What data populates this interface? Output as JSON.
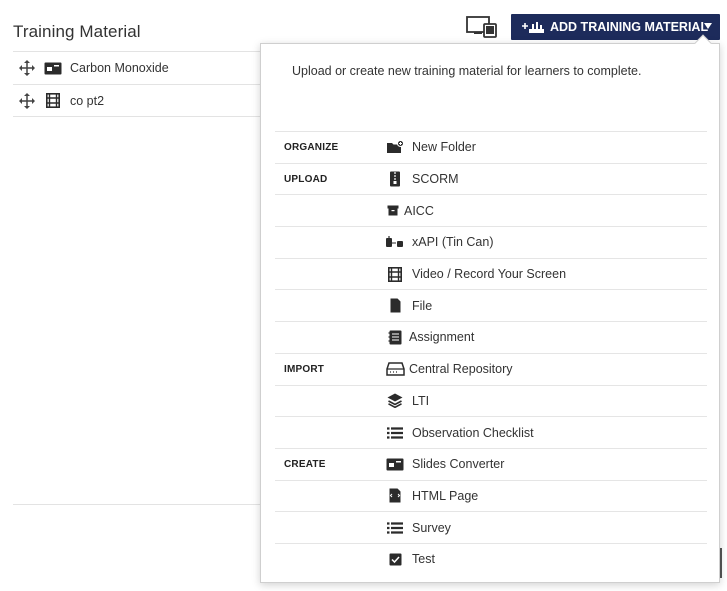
{
  "header": {
    "title": "Training Material",
    "add_button_label": "ADD TRAINING MATERIAL"
  },
  "materials": [
    {
      "name": "Carbon Monoxide",
      "type_icon": "slides-icon"
    },
    {
      "name": "co pt2",
      "type_icon": "film-icon"
    }
  ],
  "dropdown": {
    "description": "Upload or create new training material for learners to complete.",
    "items": [
      {
        "category": "ORGANIZE",
        "label": "New Folder",
        "icon": "new-folder-icon"
      },
      {
        "category": "UPLOAD",
        "label": "SCORM",
        "icon": "zip-file-icon"
      },
      {
        "category": "",
        "label": "AICC",
        "icon": "archive-box-icon"
      },
      {
        "category": "",
        "label": "xAPI (Tin Can)",
        "icon": "tin-can-icon"
      },
      {
        "category": "",
        "label": "Video / Record Your Screen",
        "icon": "film-icon"
      },
      {
        "category": "",
        "label": "File",
        "icon": "file-icon"
      },
      {
        "category": "",
        "label": "Assignment",
        "icon": "assignment-icon"
      },
      {
        "category": "IMPORT",
        "label": "Central Repository",
        "icon": "hard-drive-icon"
      },
      {
        "category": "",
        "label": "LTI",
        "icon": "layers-icon"
      },
      {
        "category": "",
        "label": "Observation Checklist",
        "icon": "list-icon"
      },
      {
        "category": "CREATE",
        "label": "Slides Converter",
        "icon": "slides-icon"
      },
      {
        "category": "",
        "label": "HTML Page",
        "icon": "html-page-icon"
      },
      {
        "category": "",
        "label": "Survey",
        "icon": "list-icon"
      },
      {
        "category": "",
        "label": "Test",
        "icon": "checkbox-icon"
      }
    ]
  },
  "colors": {
    "accent": "#1d2b5b",
    "icon": "#2b2b2b",
    "divider": "#e3e3e3"
  }
}
